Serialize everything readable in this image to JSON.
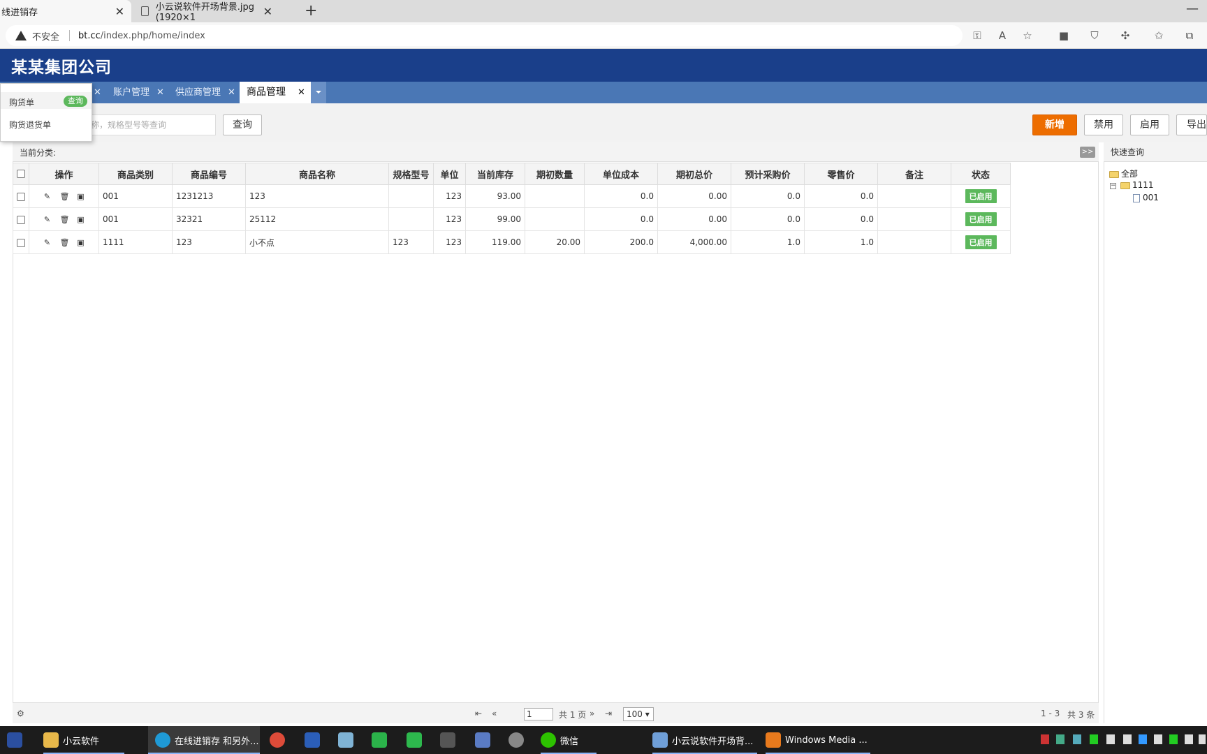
{
  "browser": {
    "active_tab_title": "线进销存",
    "inactive_tab_title": "小云说软件开场背景.jpg (1920×1",
    "insecure_label": "不安全",
    "url_host": "bt.cc",
    "url_path": "/index.php/home/index"
  },
  "header": {
    "company": "某某集团公司"
  },
  "app_tabs": [
    {
      "label": "账户管理"
    },
    {
      "label": "供应商管理"
    },
    {
      "label": "商品管理"
    }
  ],
  "dropdown": {
    "items": [
      "购货单",
      "购货退货单"
    ],
    "badge": "查询"
  },
  "toolbar": {
    "search_placeholder": "称，规格型号等查询",
    "query_btn": "查询",
    "add_btn": "新增",
    "disable_btn": "禁用",
    "enable_btn": "启用",
    "export_btn": "导出"
  },
  "category_label": "当前分类:",
  "expand_label": ">>",
  "table": {
    "columns": [
      "操作",
      "商品类别",
      "商品编号",
      "商品名称",
      "规格型号",
      "单位",
      "当前库存",
      "期初数量",
      "单位成本",
      "期初总价",
      "预计采购价",
      "零售价",
      "备注",
      "状态"
    ],
    "rows": [
      {
        "category": "001",
        "code": "1231213",
        "name": "123",
        "spec": "",
        "unit": "123",
        "stock": "93.00",
        "init_qty": "",
        "unit_cost": "0.0",
        "init_total": "0.00",
        "purchase_price": "0.0",
        "retail_price": "0.0",
        "note": "",
        "status": "已启用"
      },
      {
        "category": "001",
        "code": "32321",
        "name": "25112",
        "spec": "",
        "unit": "123",
        "stock": "99.00",
        "init_qty": "",
        "unit_cost": "0.0",
        "init_total": "0.00",
        "purchase_price": "0.0",
        "retail_price": "0.0",
        "note": "",
        "status": "已启用"
      },
      {
        "category": "1111",
        "code": "123",
        "name": "小不点",
        "spec": "123",
        "unit": "123",
        "stock": "119.00",
        "init_qty": "20.00",
        "unit_cost": "200.0",
        "init_total": "4,000.00",
        "purchase_price": "1.0",
        "retail_price": "1.0",
        "note": "",
        "status": "已启用"
      }
    ]
  },
  "pager": {
    "page": "1",
    "total_pages": "共 1 页",
    "page_size": "100",
    "range": "1 - 3",
    "total": "共 3 条"
  },
  "sidebar": {
    "title": "快速查询",
    "tree": {
      "root": "全部",
      "node": "1111",
      "leaf": "001"
    }
  },
  "taskbar": {
    "items": [
      {
        "label": "小云软件"
      },
      {
        "label": "在线进销存 和另外..."
      },
      {
        "label": "微信"
      },
      {
        "label": "小云说软件开场背..."
      },
      {
        "label": "Windows Media ..."
      }
    ]
  },
  "colors": {
    "header_bg": "#1a3f8a",
    "tabbar_bg": "#4a77b5",
    "primary_btn": "#ed6d00",
    "status_green": "#5cb85c"
  }
}
